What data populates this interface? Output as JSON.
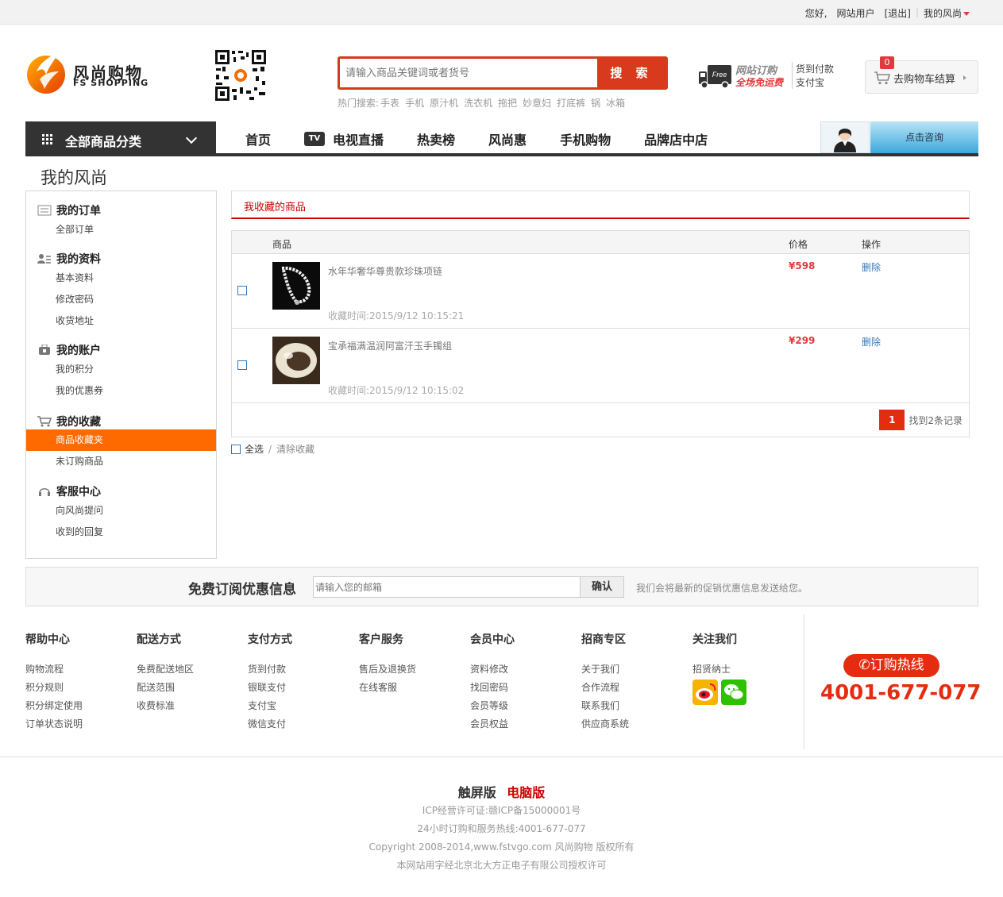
{
  "topbar": {
    "greeting": "您好,",
    "user": "网站用户",
    "logout": "[退出]",
    "my_fs": "我的风尚"
  },
  "logo": {
    "cn": "风尚购物",
    "en": "FS SHOPPING"
  },
  "search": {
    "placeholder": "请输入商品关键词或者货号",
    "button": "搜 索",
    "hot_label": "热门搜索:",
    "hot": [
      "手表",
      "手机",
      "原汁机",
      "洗衣机",
      "拖把",
      "妙意妇",
      "打底裤",
      "锅",
      "冰箱"
    ]
  },
  "promo": {
    "line1": "网站订购",
    "line2": "全场免运费",
    "line3": "货到付款",
    "line4": "支付宝",
    "truck_badge": "Free"
  },
  "cart": {
    "count": "0",
    "label": "去购物车结算"
  },
  "nav": {
    "category": "全部商品分类",
    "tv_badge": "TV",
    "items": [
      "首页",
      "电视直播",
      "热卖榜",
      "风尚惠",
      "手机购物",
      "品牌店中店"
    ],
    "consult": "点击咨询"
  },
  "page_title": "我的风尚",
  "sidebar": [
    {
      "title": "我的订单",
      "icon": "order-icon",
      "items": [
        "全部订单"
      ]
    },
    {
      "title": "我的资料",
      "icon": "profile-icon",
      "items": [
        "基本资料",
        "修改密码",
        "收货地址"
      ]
    },
    {
      "title": "我的账户",
      "icon": "account-icon",
      "items": [
        "我的积分",
        "我的优惠券"
      ]
    },
    {
      "title": "我的收藏",
      "icon": "cart-icon",
      "items": [
        "商品收藏夹",
        "未订购商品"
      ]
    },
    {
      "title": "客服中心",
      "icon": "headset-icon",
      "items": [
        "向风尚提问",
        "收到的回复"
      ]
    }
  ],
  "favorites": {
    "tab": "我收藏的商品",
    "headers": {
      "product": "商品",
      "price": "价格",
      "action": "操作"
    },
    "rows": [
      {
        "name": "水年华奢华尊贵款珍珠项链",
        "time": "收藏时间:2015/9/12 10:15:21",
        "price": "¥598",
        "action": "删除"
      },
      {
        "name": "宝承福满温润阿富汗玉手镯组",
        "time": "收藏时间:2015/9/12 10:15:02",
        "price": "¥299",
        "action": "删除"
      }
    ],
    "page": "1",
    "total": "找到2条记录",
    "select_all": "全选",
    "clear": "清除收藏"
  },
  "subscribe": {
    "title": "免费订阅优惠信息",
    "placeholder": "请输入您的邮箱",
    "button": "确认",
    "note": "我们会将最新的促销优惠信息发送给您。"
  },
  "footer": {
    "columns": [
      {
        "title": "帮助中心",
        "links": [
          "购物流程",
          "积分规则",
          "积分绑定使用",
          "订单状态说明"
        ]
      },
      {
        "title": "配送方式",
        "links": [
          "免费配送地区",
          "配送范围",
          "收费标准"
        ]
      },
      {
        "title": "支付方式",
        "links": [
          "货到付款",
          "银联支付",
          "支付宝",
          "微信支付"
        ]
      },
      {
        "title": "客户服务",
        "links": [
          "售后及退换货",
          "在线客服"
        ]
      },
      {
        "title": "会员中心",
        "links": [
          "资料修改",
          "找回密码",
          "会员等级",
          "会员权益"
        ]
      },
      {
        "title": "招商专区",
        "links": [
          "关于我们",
          "合作流程",
          "联系我们",
          "供应商系统"
        ]
      },
      {
        "title": "关注我们",
        "links": [
          "招贤纳士"
        ]
      }
    ],
    "hotline_label": "订购热线",
    "hotline": "4001-677-077",
    "version_touch": "触屏版",
    "version_pc": "电脑版",
    "icp": "ICP经营许可证:赣ICP备15000001号",
    "service": "24小时订购和服务热线:4001-677-077",
    "copyright": "Copyright 2008-2014,www.fstvgo.com 风尚购物 版权所有",
    "license": "本网站用字经北京北大方正电子有限公司授权许可"
  },
  "colors": {
    "brand_red": "#e62c10",
    "active_orange": "#ff6a00",
    "link_blue": "#3778b8",
    "nav_dark": "#333333"
  }
}
